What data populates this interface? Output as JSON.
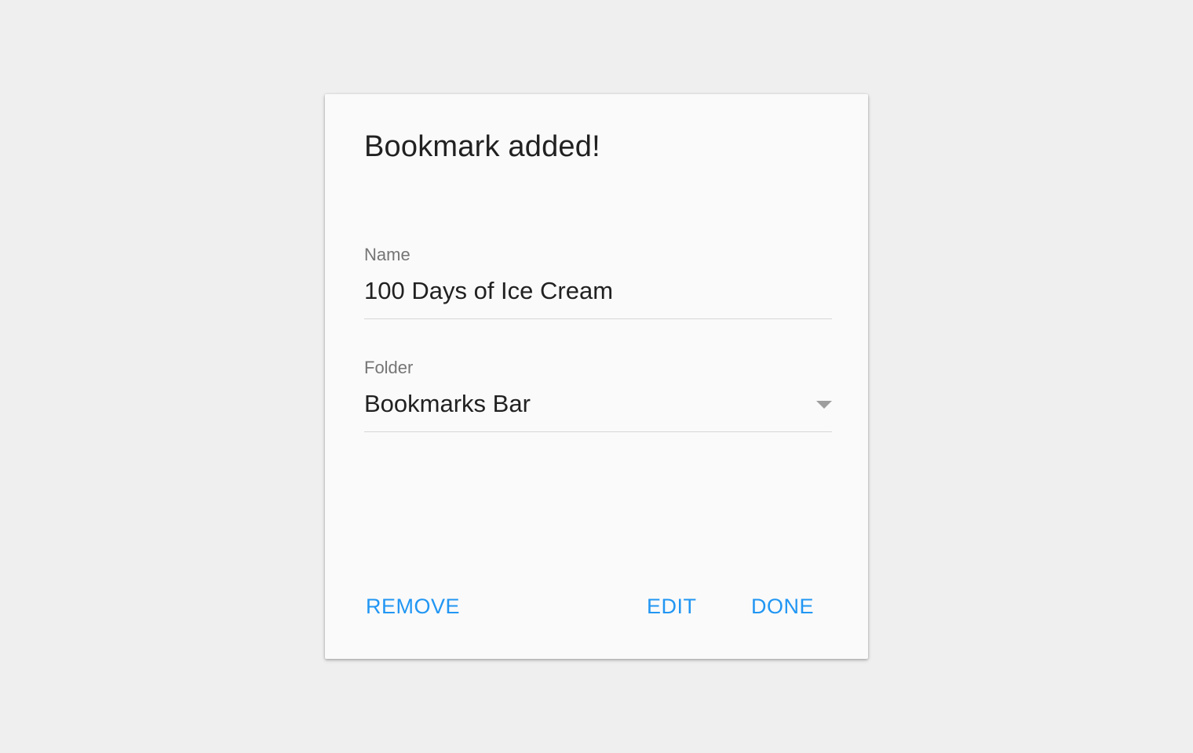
{
  "dialog": {
    "title": "Bookmark added!",
    "name_field": {
      "label": "Name",
      "value": "100 Days of Ice Cream"
    },
    "folder_field": {
      "label": "Folder",
      "value": "Bookmarks Bar",
      "icon": "dropdown-arrow-icon"
    },
    "actions": {
      "remove_label": "REMOVE",
      "edit_label": "EDIT",
      "done_label": "DONE"
    }
  },
  "colors": {
    "background": "#efefef",
    "surface": "#fafafa",
    "text_primary": "#212121",
    "text_secondary": "#757575",
    "accent": "#2196f3",
    "divider": "#d6d6d6",
    "icon": "#9e9e9e"
  }
}
